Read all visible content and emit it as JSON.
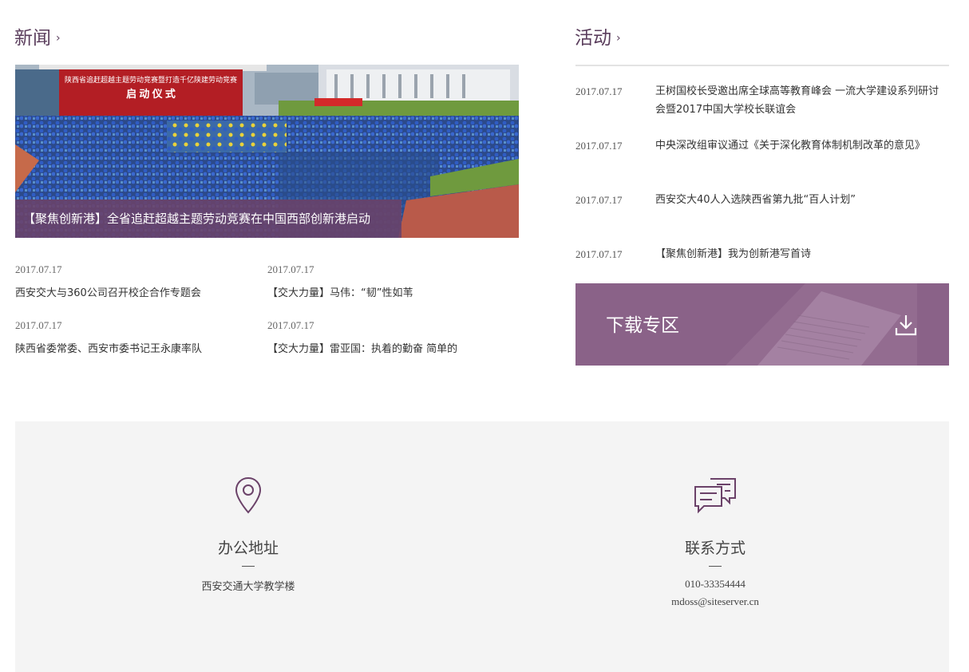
{
  "news": {
    "title": "新闻",
    "arrow": "›",
    "feature_caption": "【聚焦创新港】全省追赶超越主题劳动竞赛在中国西部创新港启动",
    "feature_banner_top": "陕西省追赶超越主题劳动竞赛暨打造千亿陕建劳动竞赛",
    "feature_banner_main": "启 动 仪 式",
    "items": [
      {
        "date": "2017.07.17",
        "text": "西安交大与360公司召开校企合作专题会"
      },
      {
        "date": "2017.07.17",
        "text": "【交大力量】马伟：“韧”性如苇"
      },
      {
        "date": "2017.07.17",
        "text": "陕西省委常委、西安市委书记王永康率队"
      },
      {
        "date": "2017.07.17",
        "text": "【交大力量】雷亚国：执着的勤奋 简单的"
      }
    ]
  },
  "activity": {
    "title": "活动",
    "arrow": "›",
    "items": [
      {
        "date": "2017.07.17",
        "text": "王树国校长受邀出席全球高等教育峰会 一流大学建设系列研讨会暨2017中国大学校长联谊会"
      },
      {
        "date": "2017.07.17",
        "text": "中央深改组审议通过《关于深化教育体制机制改革的意见》"
      },
      {
        "date": "2017.07.17",
        "text": "西安交大40人入选陕西省第九批“百人计划”"
      },
      {
        "date": "2017.07.17",
        "text": "【聚焦创新港】我为创新港写首诗"
      }
    ],
    "download_label": "下载专区"
  },
  "footer": {
    "office": {
      "heading": "办公地址",
      "line1": "西安交通大学教学楼"
    },
    "contact": {
      "heading": "联系方式",
      "phone": "010-33354444",
      "email": "mdoss@siteserver.cn"
    }
  },
  "icons": {
    "location": "location-pin-icon",
    "chat": "chat-bubbles-icon",
    "download": "download-icon"
  },
  "colors": {
    "accent": "#5a3d5c",
    "caption_bg": "#6b4269",
    "download_bg": "#8a6288",
    "footer_bg": "#f4f4f4"
  }
}
